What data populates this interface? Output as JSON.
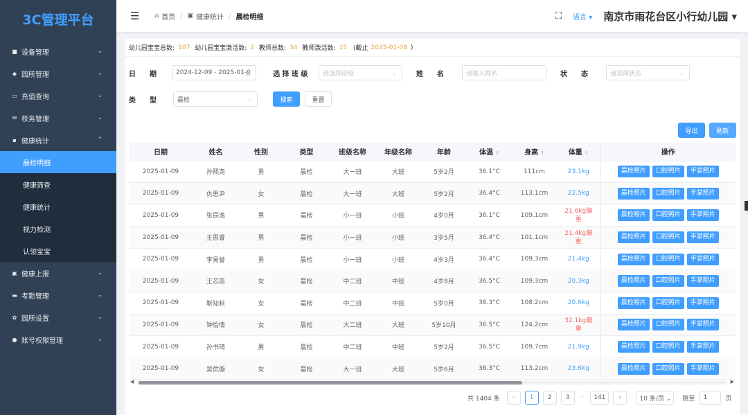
{
  "sidebar": {
    "logo": "3C管理平台",
    "items_before": [
      {
        "label": "设备管理",
        "icon": "device-icon",
        "glyph": "■",
        "arrow": "⌄"
      },
      {
        "label": "园所管理",
        "icon": "school-icon",
        "glyph": "◆",
        "arrow": "⌄"
      },
      {
        "label": "充值查询",
        "icon": "card-icon",
        "glyph": "▭",
        "arrow": "⌄"
      },
      {
        "label": "校务管理",
        "icon": "mail-icon",
        "glyph": "✉",
        "arrow": "⌄"
      }
    ],
    "health": {
      "label": "健康统计",
      "icon": "bag-icon",
      "glyph": "▪",
      "arrow": "⌃"
    },
    "health_sub": [
      {
        "label": "晨检明细",
        "active": true
      },
      {
        "label": "健康筛查"
      },
      {
        "label": "健康统计"
      },
      {
        "label": "视力检测"
      },
      {
        "label": "认领宝宝"
      }
    ],
    "items_after": [
      {
        "label": "健康上报",
        "icon": "report-icon",
        "glyph": "▣",
        "arrow": "⌄"
      },
      {
        "label": "考勤管理",
        "icon": "attendance-icon",
        "glyph": "▬",
        "arrow": "⌄"
      },
      {
        "label": "园所设置",
        "icon": "gear-icon",
        "glyph": "✿",
        "arrow": "⌄"
      },
      {
        "label": "账号权限管理",
        "icon": "users-icon",
        "glyph": "●",
        "arrow": "⌄"
      }
    ]
  },
  "navbar": {
    "hamburger": "☰",
    "breadcrumb": {
      "home_icon": "⌂",
      "home": "首页",
      "sep": "/",
      "mid_icon": "▣",
      "mid": "健康统计",
      "current": "晨检明细"
    },
    "fullscreen_glyph": "⛶",
    "language": "语言 ▾",
    "school": "南京市雨花台区小行幼儿园 ▾"
  },
  "summary": {
    "kids_total_label": "幼儿园宝宝总数:",
    "kids_total": "107",
    "kids_active_label": "幼儿园宝宝激活数:",
    "kids_active": "2",
    "teachers_label": "教师总数:",
    "teachers": "34",
    "teachers_active_label": "教师激活数:",
    "teachers_active": "15",
    "deadline_open": "(截止",
    "deadline": "2025-01-08",
    "deadline_close": ")"
  },
  "filters": {
    "date_label": "日　　期",
    "date_value": "2024-12-09 - 2025-01-0",
    "calendar_glyph": "▦",
    "class_label": "选 择 班 级",
    "class_placeholder": "请选择班级",
    "name_label": "姓　　名",
    "name_placeholder": "请输入姓名",
    "status_label": "状　　态",
    "status_placeholder": "请选择状态",
    "type_label": "类　　型",
    "type_value": "晨检",
    "dropdown_glyph": "⌄",
    "search": "搜索",
    "reset": "重置",
    "export": "导出",
    "refresh": "刷新"
  },
  "table": {
    "sort_glyph": "⇕",
    "columns": [
      "日期",
      "姓名",
      "性别",
      "类型",
      "班级名称",
      "年级名称",
      "年龄",
      "体温",
      "身高",
      "体重",
      "操作"
    ],
    "actions": [
      "晨检照片",
      "口腔照片",
      "手掌照片"
    ],
    "rows": [
      {
        "date": "2025-01-09",
        "name": "孙熙尧",
        "gender": "男",
        "type": "晨检",
        "class": "大一班",
        "grade": "大班",
        "age": "5岁2月",
        "temp": "36.1°C",
        "height": "111cm",
        "weight1": "23.1kg",
        "weight2": "",
        "alert": false
      },
      {
        "date": "2025-01-09",
        "name": "仇思尹",
        "gender": "女",
        "type": "晨检",
        "class": "大一班",
        "grade": "大班",
        "age": "5岁2月",
        "temp": "36.4°C",
        "height": "113.1cm",
        "weight1": "22.5kg",
        "weight2": "",
        "alert": false
      },
      {
        "date": "2025-01-09",
        "name": "张辰逸",
        "gender": "男",
        "type": "晨检",
        "class": "小一班",
        "grade": "小班",
        "age": "4岁0月",
        "temp": "36.1°C",
        "height": "109.1cm",
        "weight1": "21.6kg偏",
        "weight2": "重",
        "alert": true
      },
      {
        "date": "2025-01-09",
        "name": "王思睿",
        "gender": "男",
        "type": "晨检",
        "class": "小一班",
        "grade": "小班",
        "age": "3岁5月",
        "temp": "36.4°C",
        "height": "101.1cm",
        "weight1": "21.4kg偏",
        "weight2": "重",
        "alert": true
      },
      {
        "date": "2025-01-09",
        "name": "李昊誉",
        "gender": "男",
        "type": "晨检",
        "class": "小一班",
        "grade": "小班",
        "age": "4岁3月",
        "temp": "36.4°C",
        "height": "109.3cm",
        "weight1": "21.4kg",
        "weight2": "",
        "alert": false
      },
      {
        "date": "2025-01-09",
        "name": "王芯蕊",
        "gender": "女",
        "type": "晨检",
        "class": "中二班",
        "grade": "中班",
        "age": "4岁8月",
        "temp": "36.5°C",
        "height": "109.3cm",
        "weight1": "20.3kg",
        "weight2": "",
        "alert": false
      },
      {
        "date": "2025-01-09",
        "name": "靳知秋",
        "gender": "女",
        "type": "晨检",
        "class": "中二班",
        "grade": "中班",
        "age": "5岁0月",
        "temp": "36.3°C",
        "height": "108.2cm",
        "weight1": "20.6kg",
        "weight2": "",
        "alert": false
      },
      {
        "date": "2025-01-09",
        "name": "钟怡情",
        "gender": "女",
        "type": "晨检",
        "class": "大二班",
        "grade": "大班",
        "age": "5岁10月",
        "temp": "36.5°C",
        "height": "124.2cm",
        "weight1": "32.1kg偏",
        "weight2": "重",
        "alert": true
      },
      {
        "date": "2025-01-09",
        "name": "孙书琦",
        "gender": "男",
        "type": "晨检",
        "class": "中二班",
        "grade": "中班",
        "age": "5岁2月",
        "temp": "36.5°C",
        "height": "109.7cm",
        "weight1": "21.9kg",
        "weight2": "",
        "alert": false
      },
      {
        "date": "2025-01-09",
        "name": "吴优璇",
        "gender": "女",
        "type": "晨检",
        "class": "大一班",
        "grade": "大班",
        "age": "5岁6月",
        "temp": "36.3°C",
        "height": "113.2cm",
        "weight1": "23.6kg",
        "weight2": "",
        "alert": false
      }
    ]
  },
  "scrollbar": {
    "left_glyph": "◀",
    "right_glyph": "▶"
  },
  "pagination": {
    "total": "共 1404 条",
    "prev": "‹",
    "pages": [
      "1",
      "2",
      "3"
    ],
    "active_page": "1",
    "ellipsis": "···",
    "last": "141",
    "next": "›",
    "page_size": "10 条/页 ⌄",
    "goto_label": "跳至",
    "goto_value": "1",
    "goto_suffix": "页"
  },
  "colors": {
    "primary": "#409eff",
    "sidebar": "#304156",
    "submenu": "#1f2d3d",
    "warning": "#e6a23c",
    "danger": "#f56c6c"
  }
}
